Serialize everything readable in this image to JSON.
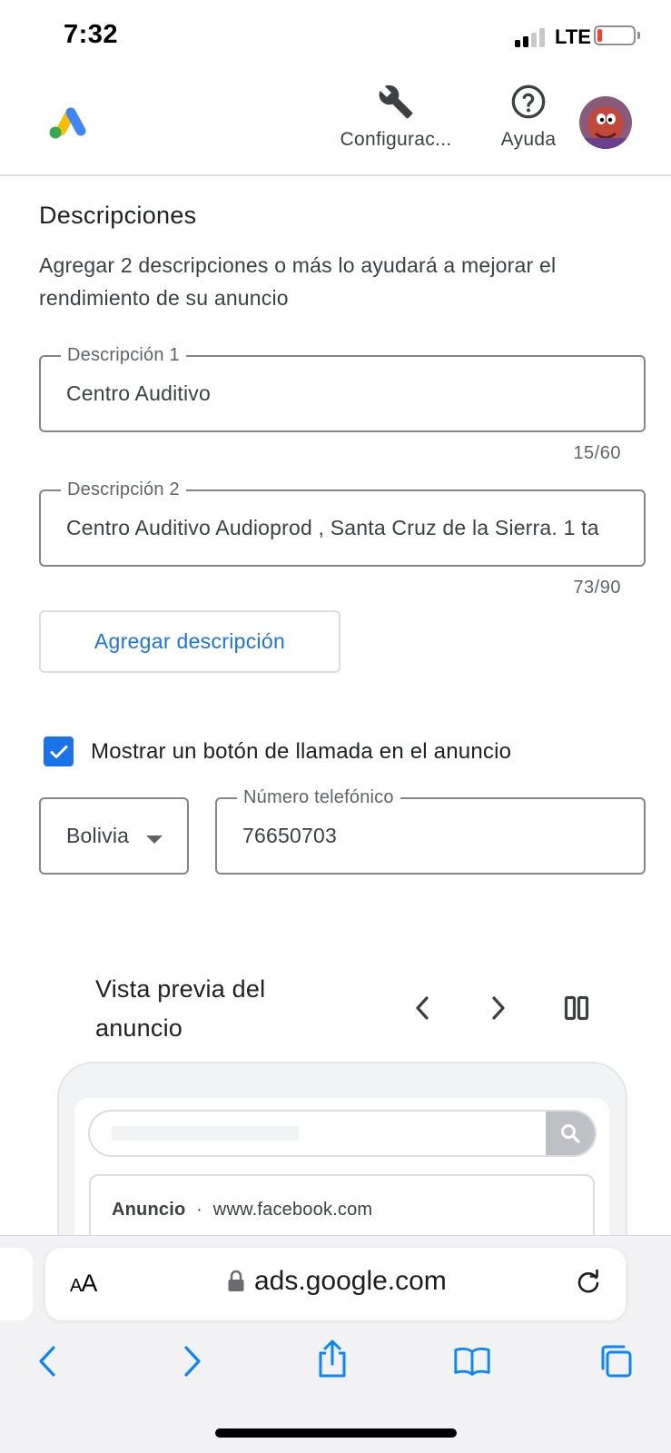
{
  "status_bar": {
    "time": "7:32",
    "network": "LTE",
    "battery_level": 0.1,
    "signal_bars": 2
  },
  "header": {
    "logo_icon": "google-ads-logo",
    "settings": {
      "label": "Configurac...",
      "icon": "wrench-icon"
    },
    "help": {
      "label": "Ayuda",
      "icon": "help-circle-icon"
    },
    "avatar_icon": "user-avatar"
  },
  "descriptions": {
    "title": "Descripciones",
    "subtitle": "Agregar 2 descripciones o más lo ayudará a mejorar el rendimiento de su anuncio",
    "fields": [
      {
        "label": "Descripción 1",
        "value": "Centro Auditivo",
        "counter": "15/60"
      },
      {
        "label": "Descripción 2",
        "value": "Centro Auditivo Audioprod , Santa Cruz de la Sierra. 1 ta",
        "counter": "73/90"
      }
    ],
    "add_button": "Agregar descripción"
  },
  "call_button": {
    "checked": true,
    "label": "Mostrar un botón de llamada en el anuncio",
    "country": "Bolivia",
    "phone_label": "Número telefónico",
    "phone_value": "76650703"
  },
  "preview": {
    "title": "Vista previa del anuncio",
    "prev_icon": "chevron-left-icon",
    "next_icon": "chevron-right-icon",
    "layout_icon": "columns-icon",
    "ad_label": "Anuncio",
    "separator": "·",
    "ad_url": "www.facebook.com"
  },
  "safari": {
    "aa_large": "A",
    "aa_small": "A",
    "url": "ads.google.com",
    "toolbar_icons": [
      "back-icon",
      "forward-icon",
      "share-icon",
      "bookmarks-icon",
      "tabs-icon"
    ]
  },
  "colors": {
    "accent": "#1a73e8",
    "text": "#202124",
    "border": "#80868b",
    "ios_blue": "#0a84ff"
  }
}
